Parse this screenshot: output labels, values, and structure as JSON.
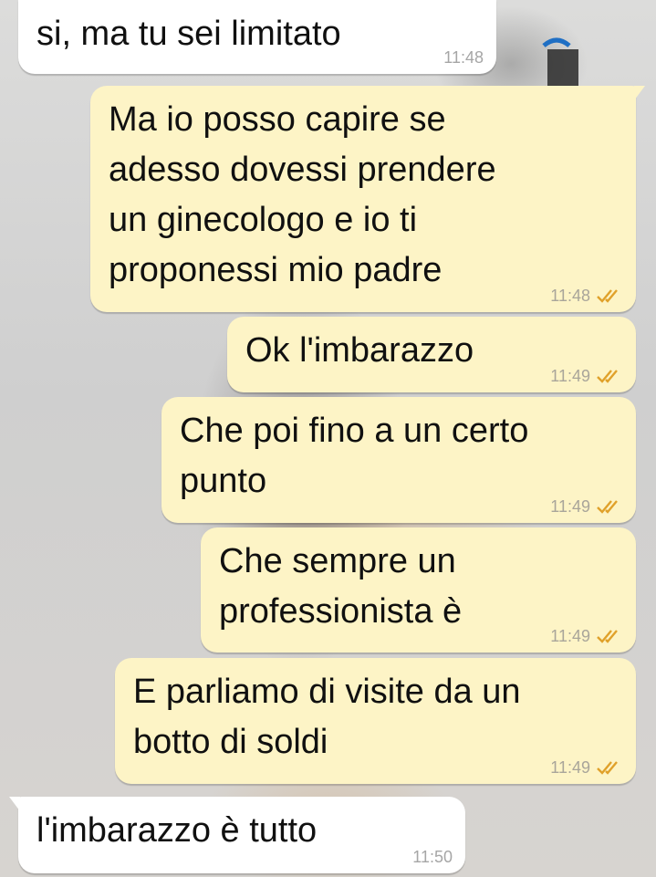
{
  "colors": {
    "incoming_bubble": "#ffffff",
    "outgoing_bubble": "#fdf4c6",
    "timestamp": "#a9a59a",
    "read_ticks": "#e0a12a"
  },
  "messages": [
    {
      "direction": "in",
      "text": "si, ma tu sei limitato",
      "time": "11:48",
      "status": ""
    },
    {
      "direction": "out",
      "text": "Ma io posso capire se\nadesso dovessi prendere\nun ginecologo e io ti\nproponessi mio padre",
      "time": "11:48",
      "status": "read-ticks-icon"
    },
    {
      "direction": "out",
      "text": "Ok l'imbarazzo",
      "time": "11:49",
      "status": "read-ticks-icon"
    },
    {
      "direction": "out",
      "text": "Che poi fino a un certo\npunto",
      "time": "11:49",
      "status": "read-ticks-icon"
    },
    {
      "direction": "out",
      "text": "Che sempre un\nprofessionista è",
      "time": "11:49",
      "status": "read-ticks-icon"
    },
    {
      "direction": "out",
      "text": "E parliamo di visite da un\nbotto di soldi",
      "time": "11:49",
      "status": "read-ticks-icon"
    },
    {
      "direction": "in",
      "text": "l'imbarazzo è tutto",
      "time": "11:50",
      "status": ""
    }
  ]
}
